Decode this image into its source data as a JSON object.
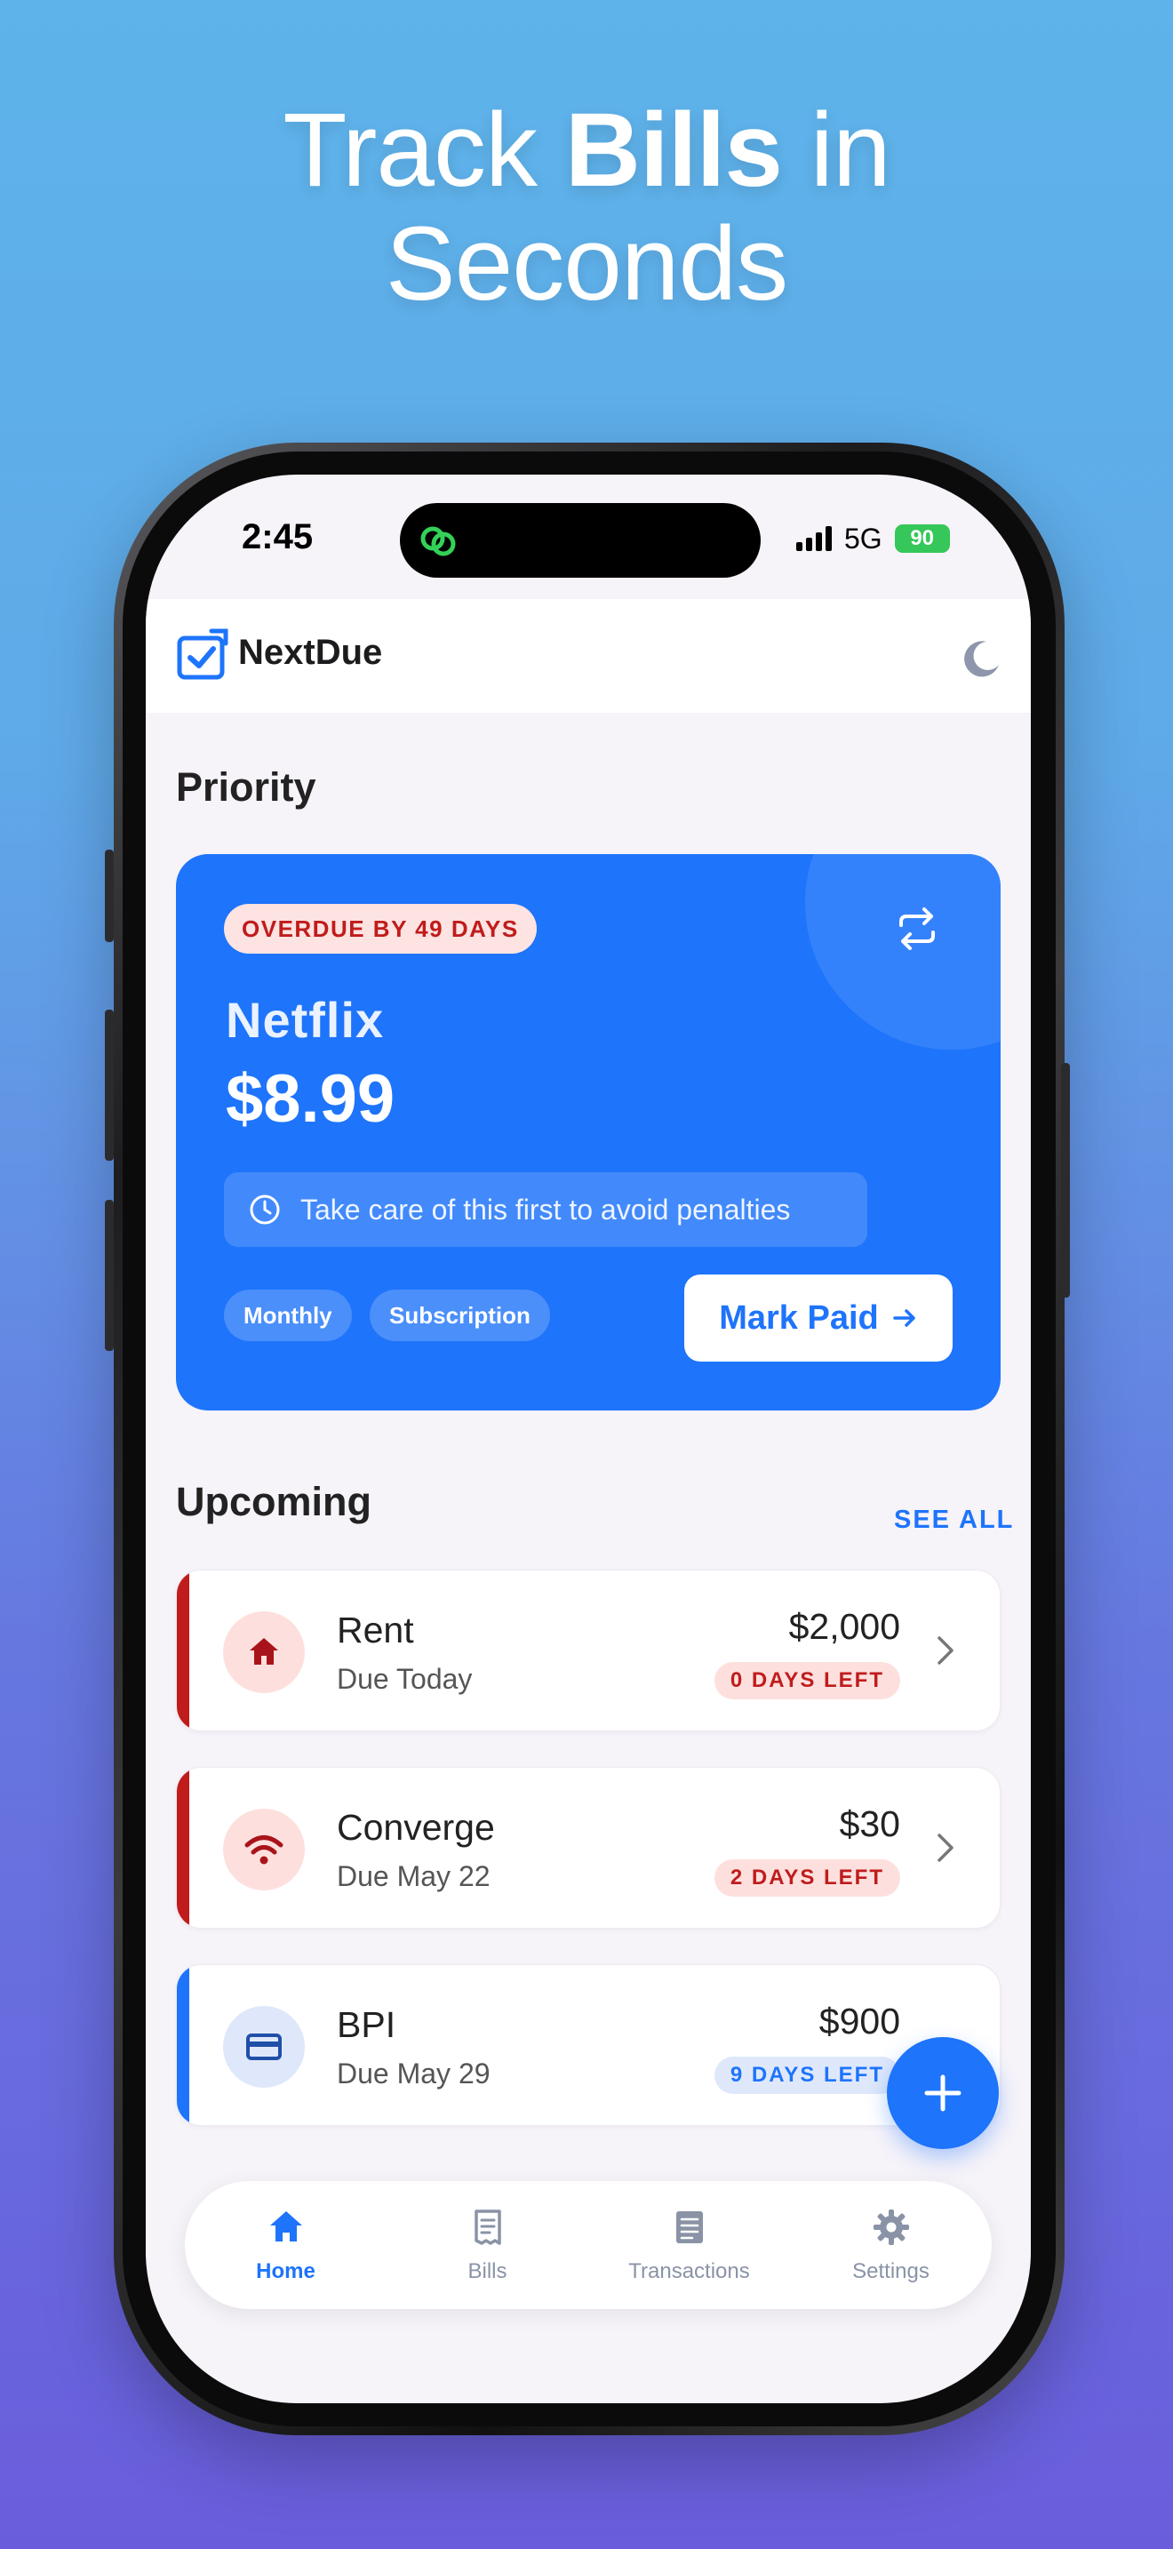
{
  "headline": {
    "line1_pre": "Track ",
    "line1_bold": "Bills",
    "line1_post": " in",
    "line2": "Seconds"
  },
  "status_bar": {
    "time": "2:45",
    "network": "5G",
    "battery": "90"
  },
  "app": {
    "name": "NextDue"
  },
  "priority": {
    "section_title": "Priority",
    "badge": "OVERDUE BY 49 DAYS",
    "bill_name": "Netflix",
    "amount": "$8.99",
    "tip": "Take care of this first to avoid penalties",
    "tags": [
      "Monthly",
      "Subscription"
    ],
    "action_label": "Mark Paid"
  },
  "upcoming": {
    "section_title": "Upcoming",
    "see_all": "SEE ALL",
    "items": [
      {
        "name": "Rent",
        "due": "Due Today",
        "amount": "$2,000",
        "days_left": "0 DAYS LEFT",
        "icon": "home-icon",
        "status": "urgent"
      },
      {
        "name": "Converge",
        "due": "Due May 22",
        "amount": "$30",
        "days_left": "2 DAYS LEFT",
        "icon": "wifi-icon",
        "status": "urgent"
      },
      {
        "name": "BPI",
        "due": "Due May 29",
        "amount": "$900",
        "days_left": "9 DAYS LEFT",
        "icon": "credit-card-icon",
        "status": "normal"
      }
    ]
  },
  "tabs": [
    {
      "label": "Home",
      "icon": "home-icon",
      "active": true
    },
    {
      "label": "Bills",
      "icon": "receipt-icon",
      "active": false
    },
    {
      "label": "Transactions",
      "icon": "list-icon",
      "active": false
    },
    {
      "label": "Settings",
      "icon": "gear-icon",
      "active": false
    }
  ],
  "colors": {
    "primary": "#1e74fb",
    "urgent": "#c01c1c",
    "urgent_bg": "#fde0de",
    "normal_bg": "#dfe8fb",
    "background": "#f6f3f9"
  }
}
